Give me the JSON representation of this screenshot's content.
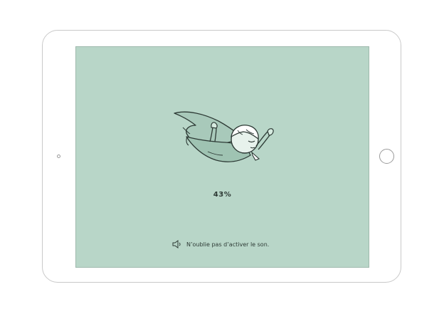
{
  "loading": {
    "progress_label": "43%",
    "progress": 0.43
  },
  "sound_hint": {
    "text": "N’oublie pas d’activer le son.",
    "icon": "speaker-icon"
  },
  "illustration": {
    "icon": "flying-child-hero-illustration"
  },
  "colors": {
    "screen_background": "#b8d6c8",
    "ink": "#2d3a35",
    "device_frame": "#c9c9c9"
  }
}
